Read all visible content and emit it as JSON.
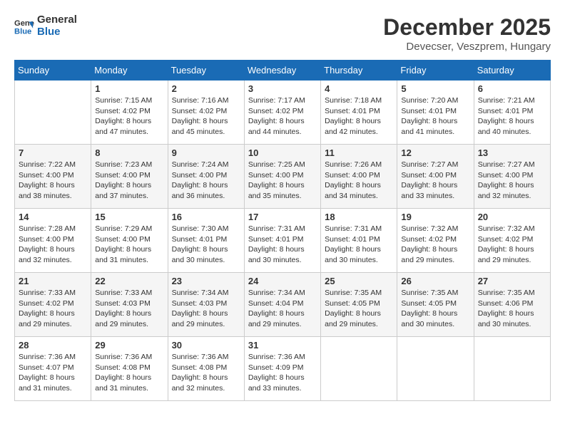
{
  "header": {
    "logo_line1": "General",
    "logo_line2": "Blue",
    "month": "December 2025",
    "location": "Devecser, Veszprem, Hungary"
  },
  "weekdays": [
    "Sunday",
    "Monday",
    "Tuesday",
    "Wednesday",
    "Thursday",
    "Friday",
    "Saturday"
  ],
  "weeks": [
    [
      {
        "day": "",
        "sunrise": "",
        "sunset": "",
        "daylight": ""
      },
      {
        "day": "1",
        "sunrise": "Sunrise: 7:15 AM",
        "sunset": "Sunset: 4:02 PM",
        "daylight": "Daylight: 8 hours and 47 minutes."
      },
      {
        "day": "2",
        "sunrise": "Sunrise: 7:16 AM",
        "sunset": "Sunset: 4:02 PM",
        "daylight": "Daylight: 8 hours and 45 minutes."
      },
      {
        "day": "3",
        "sunrise": "Sunrise: 7:17 AM",
        "sunset": "Sunset: 4:02 PM",
        "daylight": "Daylight: 8 hours and 44 minutes."
      },
      {
        "day": "4",
        "sunrise": "Sunrise: 7:18 AM",
        "sunset": "Sunset: 4:01 PM",
        "daylight": "Daylight: 8 hours and 42 minutes."
      },
      {
        "day": "5",
        "sunrise": "Sunrise: 7:20 AM",
        "sunset": "Sunset: 4:01 PM",
        "daylight": "Daylight: 8 hours and 41 minutes."
      },
      {
        "day": "6",
        "sunrise": "Sunrise: 7:21 AM",
        "sunset": "Sunset: 4:01 PM",
        "daylight": "Daylight: 8 hours and 40 minutes."
      }
    ],
    [
      {
        "day": "7",
        "sunrise": "Sunrise: 7:22 AM",
        "sunset": "Sunset: 4:00 PM",
        "daylight": "Daylight: 8 hours and 38 minutes."
      },
      {
        "day": "8",
        "sunrise": "Sunrise: 7:23 AM",
        "sunset": "Sunset: 4:00 PM",
        "daylight": "Daylight: 8 hours and 37 minutes."
      },
      {
        "day": "9",
        "sunrise": "Sunrise: 7:24 AM",
        "sunset": "Sunset: 4:00 PM",
        "daylight": "Daylight: 8 hours and 36 minutes."
      },
      {
        "day": "10",
        "sunrise": "Sunrise: 7:25 AM",
        "sunset": "Sunset: 4:00 PM",
        "daylight": "Daylight: 8 hours and 35 minutes."
      },
      {
        "day": "11",
        "sunrise": "Sunrise: 7:26 AM",
        "sunset": "Sunset: 4:00 PM",
        "daylight": "Daylight: 8 hours and 34 minutes."
      },
      {
        "day": "12",
        "sunrise": "Sunrise: 7:27 AM",
        "sunset": "Sunset: 4:00 PM",
        "daylight": "Daylight: 8 hours and 33 minutes."
      },
      {
        "day": "13",
        "sunrise": "Sunrise: 7:27 AM",
        "sunset": "Sunset: 4:00 PM",
        "daylight": "Daylight: 8 hours and 32 minutes."
      }
    ],
    [
      {
        "day": "14",
        "sunrise": "Sunrise: 7:28 AM",
        "sunset": "Sunset: 4:00 PM",
        "daylight": "Daylight: 8 hours and 32 minutes."
      },
      {
        "day": "15",
        "sunrise": "Sunrise: 7:29 AM",
        "sunset": "Sunset: 4:00 PM",
        "daylight": "Daylight: 8 hours and 31 minutes."
      },
      {
        "day": "16",
        "sunrise": "Sunrise: 7:30 AM",
        "sunset": "Sunset: 4:01 PM",
        "daylight": "Daylight: 8 hours and 30 minutes."
      },
      {
        "day": "17",
        "sunrise": "Sunrise: 7:31 AM",
        "sunset": "Sunset: 4:01 PM",
        "daylight": "Daylight: 8 hours and 30 minutes."
      },
      {
        "day": "18",
        "sunrise": "Sunrise: 7:31 AM",
        "sunset": "Sunset: 4:01 PM",
        "daylight": "Daylight: 8 hours and 30 minutes."
      },
      {
        "day": "19",
        "sunrise": "Sunrise: 7:32 AM",
        "sunset": "Sunset: 4:02 PM",
        "daylight": "Daylight: 8 hours and 29 minutes."
      },
      {
        "day": "20",
        "sunrise": "Sunrise: 7:32 AM",
        "sunset": "Sunset: 4:02 PM",
        "daylight": "Daylight: 8 hours and 29 minutes."
      }
    ],
    [
      {
        "day": "21",
        "sunrise": "Sunrise: 7:33 AM",
        "sunset": "Sunset: 4:02 PM",
        "daylight": "Daylight: 8 hours and 29 minutes."
      },
      {
        "day": "22",
        "sunrise": "Sunrise: 7:33 AM",
        "sunset": "Sunset: 4:03 PM",
        "daylight": "Daylight: 8 hours and 29 minutes."
      },
      {
        "day": "23",
        "sunrise": "Sunrise: 7:34 AM",
        "sunset": "Sunset: 4:03 PM",
        "daylight": "Daylight: 8 hours and 29 minutes."
      },
      {
        "day": "24",
        "sunrise": "Sunrise: 7:34 AM",
        "sunset": "Sunset: 4:04 PM",
        "daylight": "Daylight: 8 hours and 29 minutes."
      },
      {
        "day": "25",
        "sunrise": "Sunrise: 7:35 AM",
        "sunset": "Sunset: 4:05 PM",
        "daylight": "Daylight: 8 hours and 29 minutes."
      },
      {
        "day": "26",
        "sunrise": "Sunrise: 7:35 AM",
        "sunset": "Sunset: 4:05 PM",
        "daylight": "Daylight: 8 hours and 30 minutes."
      },
      {
        "day": "27",
        "sunrise": "Sunrise: 7:35 AM",
        "sunset": "Sunset: 4:06 PM",
        "daylight": "Daylight: 8 hours and 30 minutes."
      }
    ],
    [
      {
        "day": "28",
        "sunrise": "Sunrise: 7:36 AM",
        "sunset": "Sunset: 4:07 PM",
        "daylight": "Daylight: 8 hours and 31 minutes."
      },
      {
        "day": "29",
        "sunrise": "Sunrise: 7:36 AM",
        "sunset": "Sunset: 4:08 PM",
        "daylight": "Daylight: 8 hours and 31 minutes."
      },
      {
        "day": "30",
        "sunrise": "Sunrise: 7:36 AM",
        "sunset": "Sunset: 4:08 PM",
        "daylight": "Daylight: 8 hours and 32 minutes."
      },
      {
        "day": "31",
        "sunrise": "Sunrise: 7:36 AM",
        "sunset": "Sunset: 4:09 PM",
        "daylight": "Daylight: 8 hours and 33 minutes."
      },
      {
        "day": "",
        "sunrise": "",
        "sunset": "",
        "daylight": ""
      },
      {
        "day": "",
        "sunrise": "",
        "sunset": "",
        "daylight": ""
      },
      {
        "day": "",
        "sunrise": "",
        "sunset": "",
        "daylight": ""
      }
    ]
  ]
}
